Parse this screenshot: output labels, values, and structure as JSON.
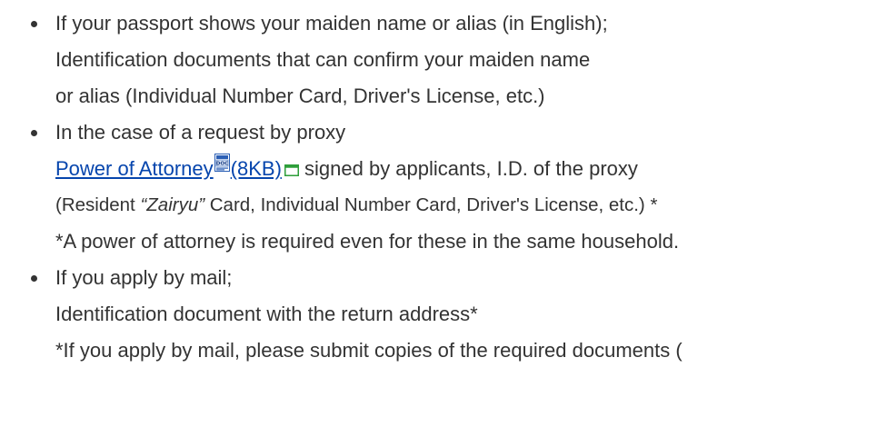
{
  "items": [
    {
      "lines": [
        "If your passport shows your maiden name or alias (in English);",
        "Identification documents that can confirm your maiden name",
        "or alias (Individual Number Card, Driver's License, etc.)"
      ]
    },
    {
      "heading": "In the case of a request by proxy",
      "link_text": "Power of Attorney",
      "link_size": "(8KB)",
      "link_icon": "word-doc-icon",
      "external_icon": "new-window-icon",
      "after_link": " signed by applicants, I.D. of the proxy",
      "id_prefix": "(Resident ",
      "id_italic": "“Zairyu”",
      "id_suffix": " Card, Individual Number Card, Driver's License, etc.) *",
      "note": "*A power of attorney is required even for these in the same household."
    },
    {
      "lines": [
        "If you apply by mail;",
        "Identification document with the return address*",
        "*If you apply by mail, please submit copies of the required documents ("
      ]
    }
  ],
  "colors": {
    "text": "#333333",
    "link": "#0645ad",
    "doc_icon_blue": "#2b5fb5",
    "window_icon_green": "#2e9e3a"
  }
}
